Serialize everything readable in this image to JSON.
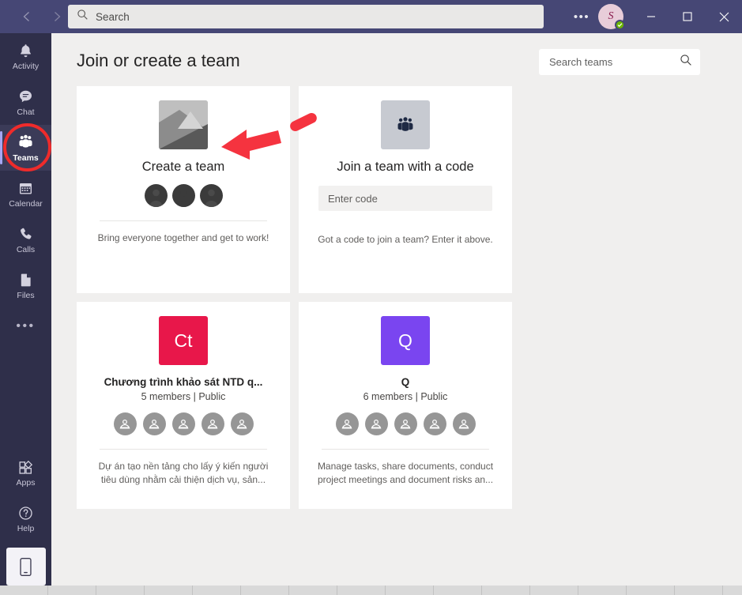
{
  "titlebar": {
    "back_icon": "chevron-left-icon",
    "forward_icon": "chevron-right-icon",
    "search_placeholder": "Search",
    "search_icon": "search-icon",
    "more_label": "•••",
    "avatar_initial": "S",
    "presence": "available",
    "minimize_label": "minimize",
    "maximize_label": "maximize",
    "close_label": "close"
  },
  "rail": {
    "items": [
      {
        "label": "Activity",
        "icon": "bell-icon",
        "active": false
      },
      {
        "label": "Chat",
        "icon": "chat-icon",
        "active": false
      },
      {
        "label": "Teams",
        "icon": "people-icon",
        "active": true
      },
      {
        "label": "Calendar",
        "icon": "calendar-icon",
        "active": false
      },
      {
        "label": "Calls",
        "icon": "phone-icon",
        "active": false
      },
      {
        "label": "Files",
        "icon": "file-icon",
        "active": false
      }
    ],
    "more_label": "•••",
    "bottom_items": [
      {
        "label": "Apps",
        "icon": "apps-icon"
      },
      {
        "label": "Help",
        "icon": "help-icon"
      }
    ],
    "phone_icon": "mobile-device-icon"
  },
  "main": {
    "page_title": "Join or create a team",
    "search_teams": {
      "placeholder": "Search teams",
      "icon": "search-icon"
    },
    "cards": [
      {
        "kind": "create",
        "thumb": "image-placeholder-icon",
        "title": "Create a team",
        "avatars": 3,
        "description": "Bring everyone together and get to work!"
      },
      {
        "kind": "join-code",
        "thumb": "people-icon",
        "title": "Join a team with a code",
        "input_placeholder": "Enter code",
        "note": "Got a code to join a team? Enter it above."
      },
      {
        "kind": "team",
        "initials": "Ct",
        "color": "#e8174a",
        "title": "Chương trình khảo sát NTD q...",
        "meta": "5 members  |  Public",
        "avatars": 5,
        "description": "Dự án tạo nền tảng cho lấy ý kiến người tiêu dùng nhằm cải thiện dịch vụ, sản..."
      },
      {
        "kind": "team",
        "initials": "Q",
        "color": "#7a45f0",
        "title": "Q",
        "meta": "6 members  |  Public",
        "avatars": 5,
        "description": "Manage tasks, share documents, conduct project meetings and document risks an..."
      }
    ]
  },
  "annotations": {
    "circle_target": "Teams",
    "arrow_target": "Create a team",
    "color": "#f5333f"
  }
}
